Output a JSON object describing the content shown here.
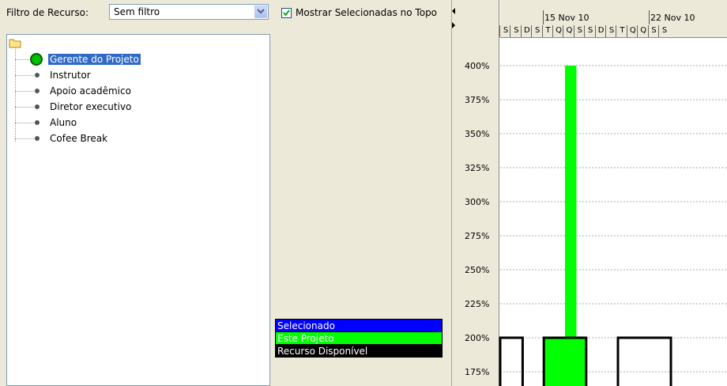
{
  "filter": {
    "label": "Filtro de Recurso:",
    "selected": "Sem filtro"
  },
  "tree": {
    "items": [
      {
        "label": "Gerente do Projeto",
        "selected": true
      },
      {
        "label": "Instrutor",
        "selected": false
      },
      {
        "label": "Apoio acadêmico",
        "selected": false
      },
      {
        "label": "Diretor executivo",
        "selected": false
      },
      {
        "label": "Aluno",
        "selected": false
      },
      {
        "label": "Cofee Break",
        "selected": false
      }
    ]
  },
  "options": {
    "show_selected_top_label": "Mostrar Selecionadas no Topo",
    "show_selected_top_checked": true
  },
  "legend": {
    "items": [
      {
        "label": "Selecionado",
        "color": "#0000ff"
      },
      {
        "label": "Este Projeto",
        "color": "#00ff00"
      },
      {
        "label": "Recurso Disponível",
        "color": "#000000"
      }
    ]
  },
  "timeline": {
    "weeks": [
      "15 Nov 10",
      "22 Nov 10"
    ],
    "days": [
      "S",
      "S",
      "D",
      "S",
      "T",
      "Q",
      "Q",
      "S",
      "S",
      "D",
      "S",
      "T",
      "Q",
      "Q",
      "S",
      "S"
    ]
  },
  "chart_data": {
    "type": "bar",
    "yticks": [
      "400%",
      "375%",
      "350%",
      "325%",
      "300%",
      "275%",
      "250%",
      "225%",
      "200%",
      "175%"
    ],
    "series": [
      {
        "name": "Este Projeto",
        "color": "#00ff00",
        "segments": [
          {
            "start_day": 3,
            "end_day": 7,
            "value": 200
          },
          {
            "start_day": 5,
            "end_day": 6,
            "value": 400
          }
        ]
      },
      {
        "name": "Recurso Disponível",
        "color": "#000000",
        "segments": [
          {
            "start_day": 0,
            "end_day": 1,
            "value": 200
          },
          {
            "start_day": 3,
            "end_day": 7,
            "value": 200
          },
          {
            "start_day": 10,
            "end_day": 15,
            "value": 200
          }
        ]
      }
    ]
  }
}
